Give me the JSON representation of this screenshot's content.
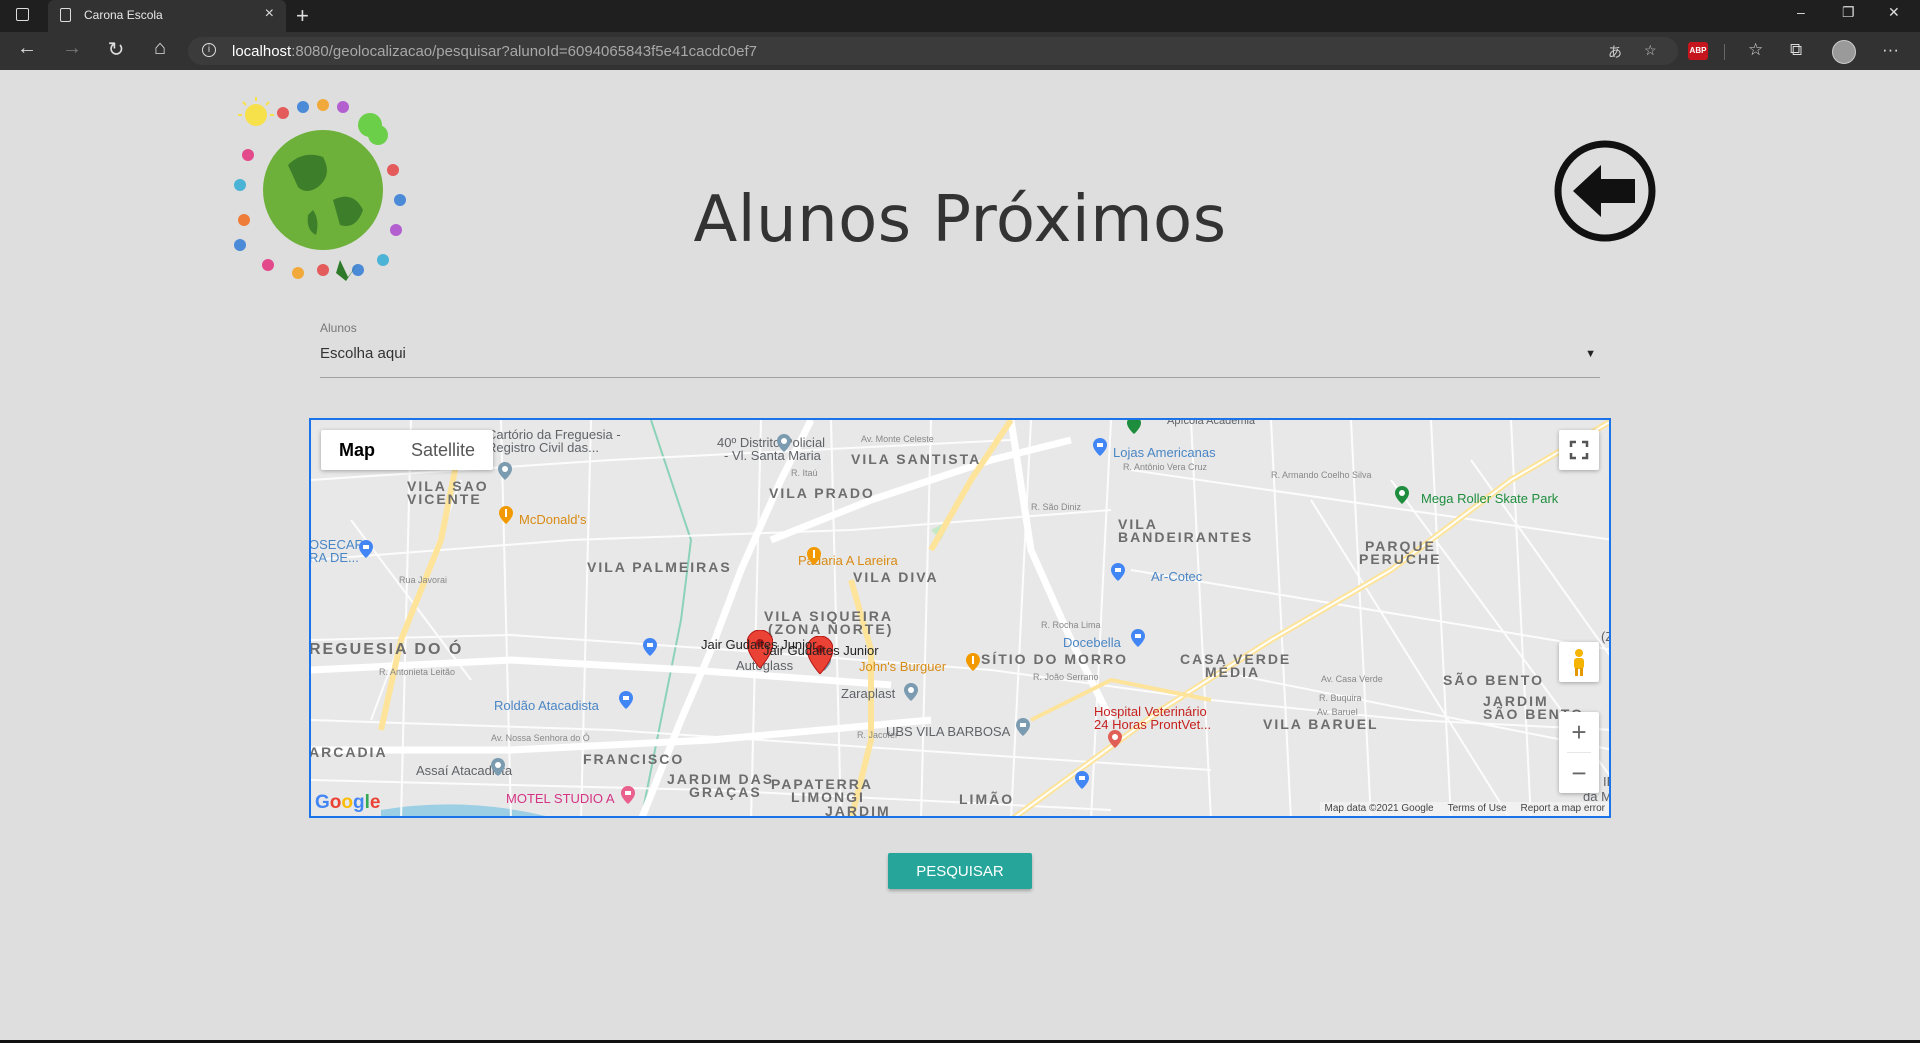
{
  "browser": {
    "tab_title": "Carona Escola",
    "tab_close": "×",
    "new_tab": "+",
    "url_host": "localhost",
    "url_rest": ":8080/geolocalizacao/pesquisar?alunoId=6094065843f5e41cacdc0ef7",
    "win_min": "–",
    "win_restore": "❐",
    "win_close": "✕",
    "more": "···"
  },
  "page": {
    "title": "Alunos Próximos"
  },
  "select": {
    "label": "Alunos",
    "value": "Escolha aqui",
    "caret": "▼"
  },
  "map": {
    "type_map": "Map",
    "type_satellite": "Satellite",
    "areas": [
      "VILA SANTISTA",
      "VILA PRADO",
      "VILA SAO",
      "VICENTE",
      "VILA PALMEIRAS",
      "VILA DIVA",
      "VILA",
      "BANDEIRANTES",
      "PARQUE",
      "PERUCHE",
      "VILA SIQUEIRA",
      "(ZONA NORTE)",
      "REGUESIA DO Ó",
      "SÍTIO DO MORRO",
      "CASA VERDE",
      "MÉDIA",
      "SÃO BENTO",
      "JARDIM",
      "SÃO BENTO",
      "ARCADIA",
      "FRANCISCO",
      "JARDIM DAS",
      "GRAÇAS",
      "PAPATERRA",
      "LIMONGI",
      "JARDIM",
      "LIMÃO",
      "VILA BARUEL"
    ],
    "pois": {
      "cartorio_1": "Cartório da Freguesia -",
      "cartorio_2": "Registro Civil das...",
      "distrito_1": "40º Distrito Policial",
      "distrito_2": "- Vl. Santa Maria",
      "lojas": "Lojas Americanas",
      "mega": "Mega Roller Skate Park",
      "mcdonalds": "McDonald's",
      "padaria": "Padaria A Lareira",
      "arcotec": "Ar-Cotec",
      "docebella": "Docebella",
      "johns": "John's Burguer",
      "zaraplast": "Zaraplast",
      "ubs": "UBS VILA BARBOSA",
      "hospital_1": "Hospital Veterinário",
      "hospital_2": "24 Horas ProntVet...",
      "roldao": "Roldão Atacadista",
      "assai": "Assaí Atacadista",
      "motel": "MOTEL STUDIO A",
      "autoglass": "Autoglass",
      "marker_1": "Jair Gudaites Junior",
      "marker_2": "Jair Gudaites Junior",
      "osecar_1": "OSECAR",
      "osecar_2": "RA DE...",
      "z_edge": "(Z",
      "ie_edge": "IE",
      "dam_edge": "da M",
      "apicola": "Apícola Academia"
    },
    "streets": [
      "Av. Monte Celeste",
      "R. Itaú",
      "R. São Diniz",
      "R. Antônio Vera Cruz",
      "R. Armando Coelho Silva",
      "Rua Javorai",
      "R. Antonieta Leitão",
      "Av. Nossa Senhora do Ó",
      "R. Rocha Lima",
      "Av. Casa Verde",
      "R. Buquira",
      "Av. Baruel",
      "R. Jacofer",
      "R. João Serrano"
    ],
    "google": "Google",
    "attribution": [
      "Map data ©2021 Google",
      "Terms of Use",
      "Report a map error"
    ],
    "zoom_in": "+",
    "zoom_out": "−"
  },
  "button": {
    "search": "PESQUISAR"
  }
}
